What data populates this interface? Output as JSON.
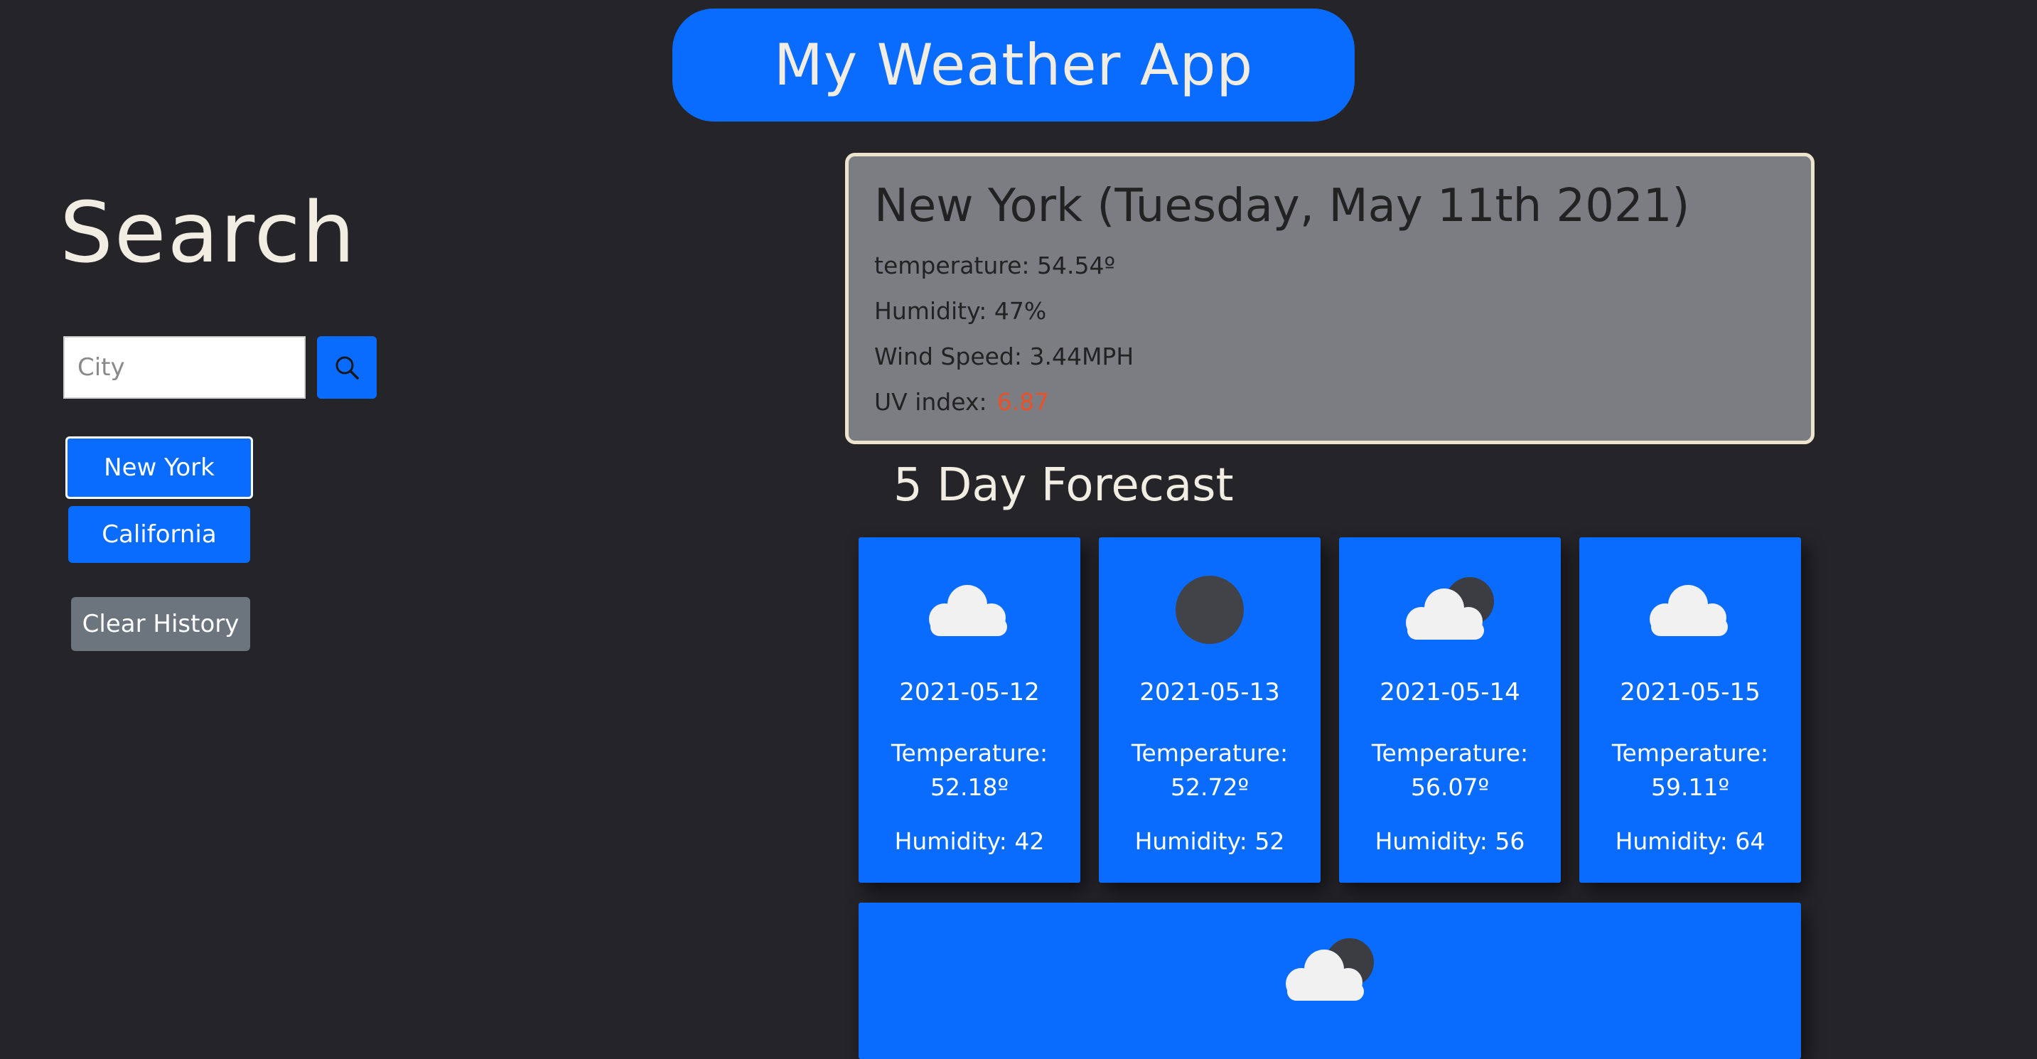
{
  "header": {
    "title": "My Weather App"
  },
  "search": {
    "title": "Search",
    "placeholder": "City",
    "button_icon": "search-icon"
  },
  "history": {
    "items": [
      {
        "label": "New York",
        "active": true
      },
      {
        "label": "California",
        "active": false
      }
    ],
    "clear_label": "Clear History"
  },
  "current": {
    "title": "New York (Tuesday, May 11th 2021)",
    "temperature": "temperature: 54.54º",
    "humidity": "Humidity: 47%",
    "wind": "Wind Speed: 3.44MPH",
    "uv_label": "UV index:",
    "uv_value": "6.87",
    "uv_color": "#e8522a"
  },
  "forecast": {
    "title": "5 Day Forecast",
    "days": [
      {
        "icon": "cloud-icon",
        "date": "2021-05-12",
        "temp_label": "Temperature:",
        "temp_value": "52.18º",
        "humidity": "Humidity: 42"
      },
      {
        "icon": "moon-icon",
        "date": "2021-05-13",
        "temp_label": "Temperature:",
        "temp_value": "52.72º",
        "humidity": "Humidity: 52"
      },
      {
        "icon": "cloud-moon-icon",
        "date": "2021-05-14",
        "temp_label": "Temperature:",
        "temp_value": "56.07º",
        "humidity": "Humidity: 56"
      },
      {
        "icon": "cloud-icon",
        "date": "2021-05-15",
        "temp_label": "Temperature:",
        "temp_value": "59.11º",
        "humidity": "Humidity: 64"
      }
    ],
    "partial_day": {
      "icon": "cloud-moon-icon"
    }
  },
  "colors": {
    "accent": "#0a6cff",
    "background": "#242429",
    "card": "#7c7d83",
    "card_border": "#ede4cf",
    "clear_button": "#6c757d",
    "title_text": "#f1ede3"
  }
}
